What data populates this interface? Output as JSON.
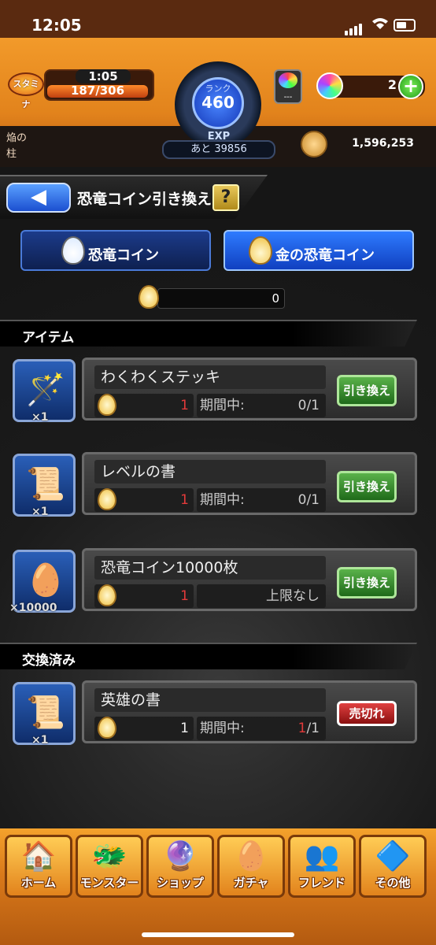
{
  "status": {
    "time": "12:05"
  },
  "header": {
    "stamina_label": "スタミナ",
    "stamina_timer": "1:05",
    "stamina_value": "187/306",
    "rank_label": "ランク",
    "rank_value": "460",
    "exp_label": "EXP",
    "exp_remaining": "あと 39856",
    "luck_value": "---",
    "orb_count": "2",
    "title_line1": "焔の",
    "title_line2": "柱",
    "gold": "1,596,253"
  },
  "page": {
    "title": "恐竜コイン引き換え",
    "help": "?",
    "back": "◀",
    "tabs": [
      {
        "label": "恐竜コイン",
        "active": false
      },
      {
        "label": "金の恐竜コイン",
        "active": true
      }
    ],
    "coin_count": "0"
  },
  "sections": {
    "items_title": "アイテム",
    "exchanged_title": "交換済み"
  },
  "items": [
    {
      "name": "わくわくステッキ",
      "qty": "×1",
      "cost": "1",
      "period_label": "期間中:",
      "limit": "0/1",
      "button": "引き換え",
      "icon": "staff-icon"
    },
    {
      "name": "レベルの書",
      "qty": "×1",
      "cost": "1",
      "period_label": "期間中:",
      "limit": "0/1",
      "button": "引き換え",
      "icon": "scroll-icon"
    },
    {
      "name": "恐竜コイン10000枚",
      "qty": "×10000",
      "cost": "1",
      "limit_text": "上限なし",
      "button": "引き換え",
      "icon": "egg-icon"
    }
  ],
  "exchanged": [
    {
      "name": "英雄の書",
      "qty": "×1",
      "cost": "1",
      "period_label": "期間中:",
      "limit_used": "1",
      "limit_total": "/1",
      "button": "売切れ",
      "icon": "scroll-icon"
    }
  ],
  "nav": [
    {
      "label": "ホーム",
      "icon": "home-icon"
    },
    {
      "label": "モンスター",
      "icon": "monster-icon"
    },
    {
      "label": "ショップ",
      "icon": "orb-icon"
    },
    {
      "label": "ガチャ",
      "icon": "gacha-icon"
    },
    {
      "label": "フレンド",
      "icon": "friend-icon"
    },
    {
      "label": "その他",
      "icon": "other-icon"
    }
  ]
}
